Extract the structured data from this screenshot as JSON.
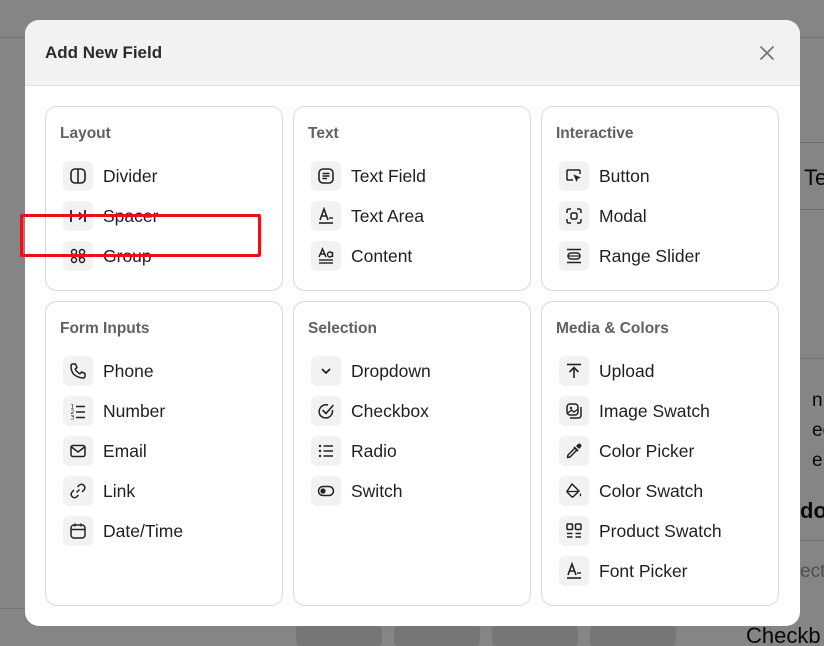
{
  "background": {
    "fragments": [
      "Te",
      "n ip",
      "ed",
      "e m",
      "do",
      "ect",
      "Checkb"
    ]
  },
  "modal": {
    "title": "Add New Field",
    "close_icon": "close-icon"
  },
  "categories": [
    {
      "title": "Layout",
      "items": [
        {
          "label": "Divider",
          "icon": "columns-icon"
        },
        {
          "label": "Spacer",
          "icon": "spacer-icon"
        },
        {
          "label": "Group",
          "icon": "group-icon"
        }
      ]
    },
    {
      "title": "Text",
      "items": [
        {
          "label": "Text Field",
          "icon": "text-field-icon"
        },
        {
          "label": "Text Area",
          "icon": "text-area-icon"
        },
        {
          "label": "Content",
          "icon": "content-icon"
        }
      ]
    },
    {
      "title": "Interactive",
      "items": [
        {
          "label": "Button",
          "icon": "cursor-click-icon"
        },
        {
          "label": "Modal",
          "icon": "modal-icon"
        },
        {
          "label": "Range Slider",
          "icon": "range-slider-icon"
        }
      ]
    },
    {
      "title": "Form Inputs",
      "items": [
        {
          "label": "Phone",
          "icon": "phone-icon"
        },
        {
          "label": "Number",
          "icon": "number-list-icon"
        },
        {
          "label": "Email",
          "icon": "mail-icon"
        },
        {
          "label": "Link",
          "icon": "link-icon"
        },
        {
          "label": "Date/Time",
          "icon": "calendar-icon"
        }
      ]
    },
    {
      "title": "Selection",
      "items": [
        {
          "label": "Dropdown",
          "icon": "chevron-down-icon"
        },
        {
          "label": "Checkbox",
          "icon": "check-circle-icon"
        },
        {
          "label": "Radio",
          "icon": "list-icon"
        },
        {
          "label": "Switch",
          "icon": "toggle-icon"
        }
      ]
    },
    {
      "title": "Media & Colors",
      "items": [
        {
          "label": "Upload",
          "icon": "upload-icon"
        },
        {
          "label": "Image Swatch",
          "icon": "image-swatch-icon"
        },
        {
          "label": "Color Picker",
          "icon": "eyedropper-icon"
        },
        {
          "label": "Color Swatch",
          "icon": "paint-bucket-icon"
        },
        {
          "label": "Product Swatch",
          "icon": "product-swatch-icon"
        },
        {
          "label": "Font Picker",
          "icon": "font-icon"
        }
      ]
    }
  ],
  "colors": {
    "highlight": "#e0141b",
    "header_bg": "#f2f2f2",
    "icon_bg": "#f2f2f2",
    "card_border": "#d9d9d9"
  }
}
